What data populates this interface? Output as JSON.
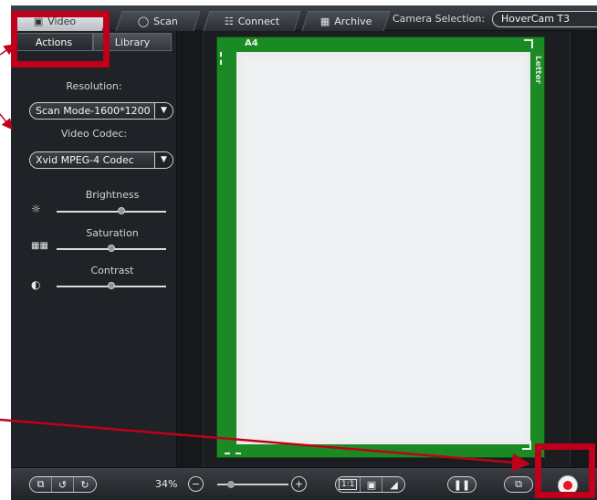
{
  "top_tabs": [
    {
      "label": "Video",
      "icon": "video-icon",
      "active": true
    },
    {
      "label": "Scan",
      "icon": "scan-icon"
    },
    {
      "label": "Connect",
      "icon": "connect-icon"
    },
    {
      "label": "Archive",
      "icon": "archive-icon"
    }
  ],
  "camera": {
    "label": "Camera Selection:",
    "value": "HoverCam T3"
  },
  "sub_tabs": [
    {
      "label": "Actions",
      "active": true
    },
    {
      "label": "Library"
    }
  ],
  "resolution": {
    "label": "Resolution:",
    "value": "Scan Mode-1600*1200"
  },
  "codec": {
    "label": "Video Codec:",
    "value": "Xvid MPEG-4 Codec"
  },
  "adjustments": [
    {
      "label": "Brightness",
      "icon": "brightness-icon",
      "level": 0.6
    },
    {
      "label": "Saturation",
      "icon": "saturation-icon",
      "level": 0.5
    },
    {
      "label": "Contrast",
      "icon": "contrast-icon",
      "level": 0.5
    }
  ],
  "preview": {
    "a4_label": "A4",
    "letter_label": "Letter"
  },
  "toolbar": {
    "zoom_percent": "34%",
    "zoom_level": 0.15,
    "fit_1_1": "1:1",
    "record_color": "#e0182a"
  },
  "colors": {
    "highlight": "#c0001b",
    "paper_background": "#1c8a24"
  }
}
